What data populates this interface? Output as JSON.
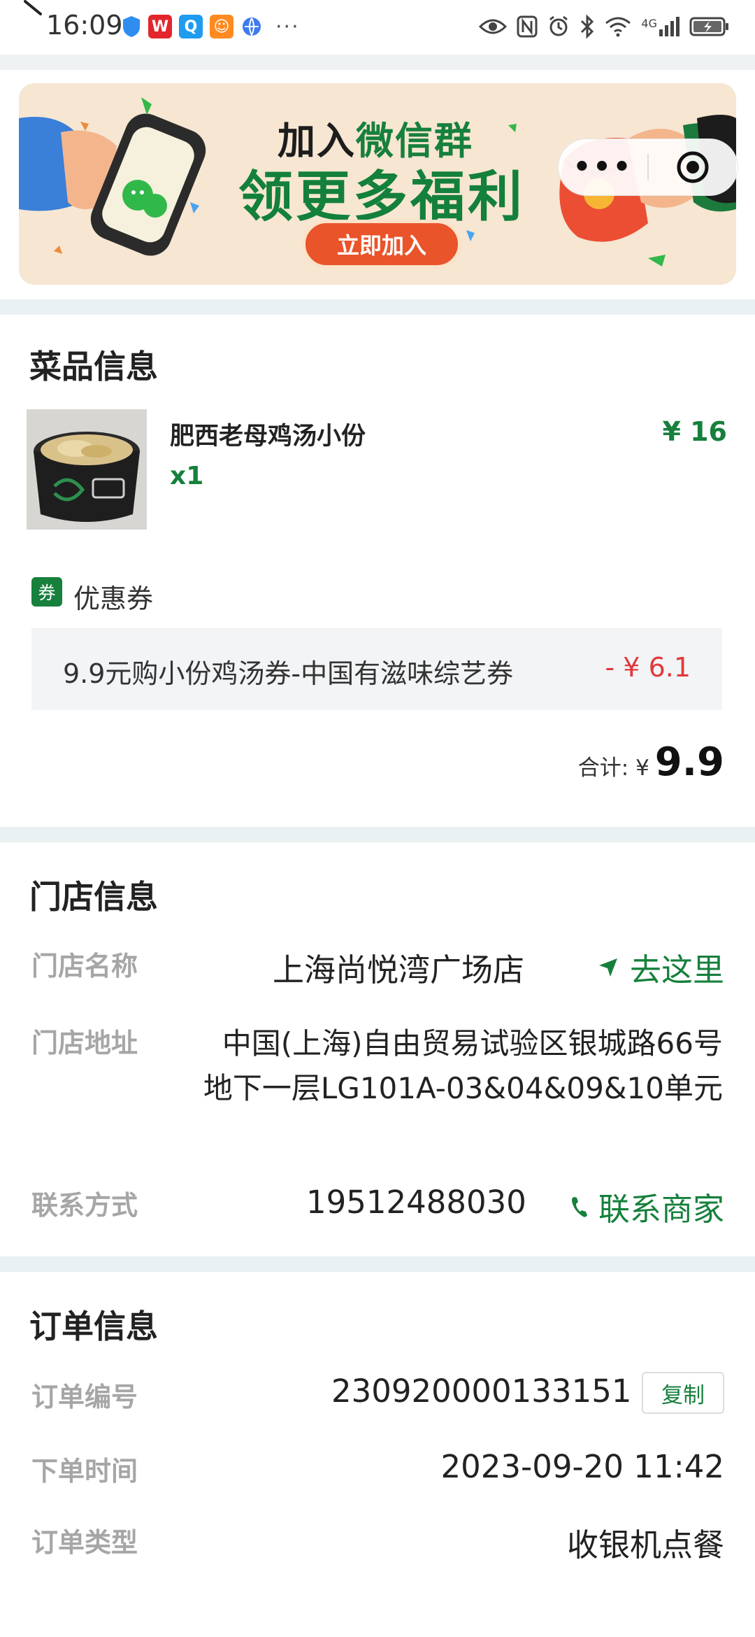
{
  "status_bar": {
    "time": "16:09",
    "more": "···",
    "network": "4G",
    "battery": "battery-charging"
  },
  "banner": {
    "title_prefix": "加入",
    "title_highlight": "微信群",
    "headline": "领更多福利",
    "button": "立即加入"
  },
  "capsule": {
    "more": "•••"
  },
  "dish_section": {
    "title": "菜品信息",
    "dish": {
      "name": "肥西老母鸡汤小份",
      "qty": "x1",
      "price": "¥ 16"
    },
    "coupon_badge": "券",
    "coupon_label": "优惠券",
    "coupon": {
      "name": "9.9元购小份鸡汤券-中国有滋味综艺券",
      "amount": "- ¥ 6.1"
    },
    "total_label": "合计: ¥",
    "total_value": "9.9"
  },
  "store_section": {
    "title": "门店信息",
    "name_label": "门店名称",
    "name": "上海尚悦湾广场店",
    "navigate": "去这里",
    "address_label": "门店地址",
    "address": "中国(上海)自由贸易试验区银城路66号地下一层LG101A-03&04&09&10单元",
    "contact_label": "联系方式",
    "phone": "19512488030",
    "contact_action": "联系商家"
  },
  "order_section": {
    "title": "订单信息",
    "number_label": "订单编号",
    "number": "230920000133151",
    "copy": "复制",
    "time_label": "下单时间",
    "time": "2023-09-20 11:42",
    "type_label": "订单类型",
    "type": "收银机点餐"
  },
  "colors": {
    "accent": "#16803c",
    "discount": "#e0393b",
    "background": "#e9f1f2"
  }
}
